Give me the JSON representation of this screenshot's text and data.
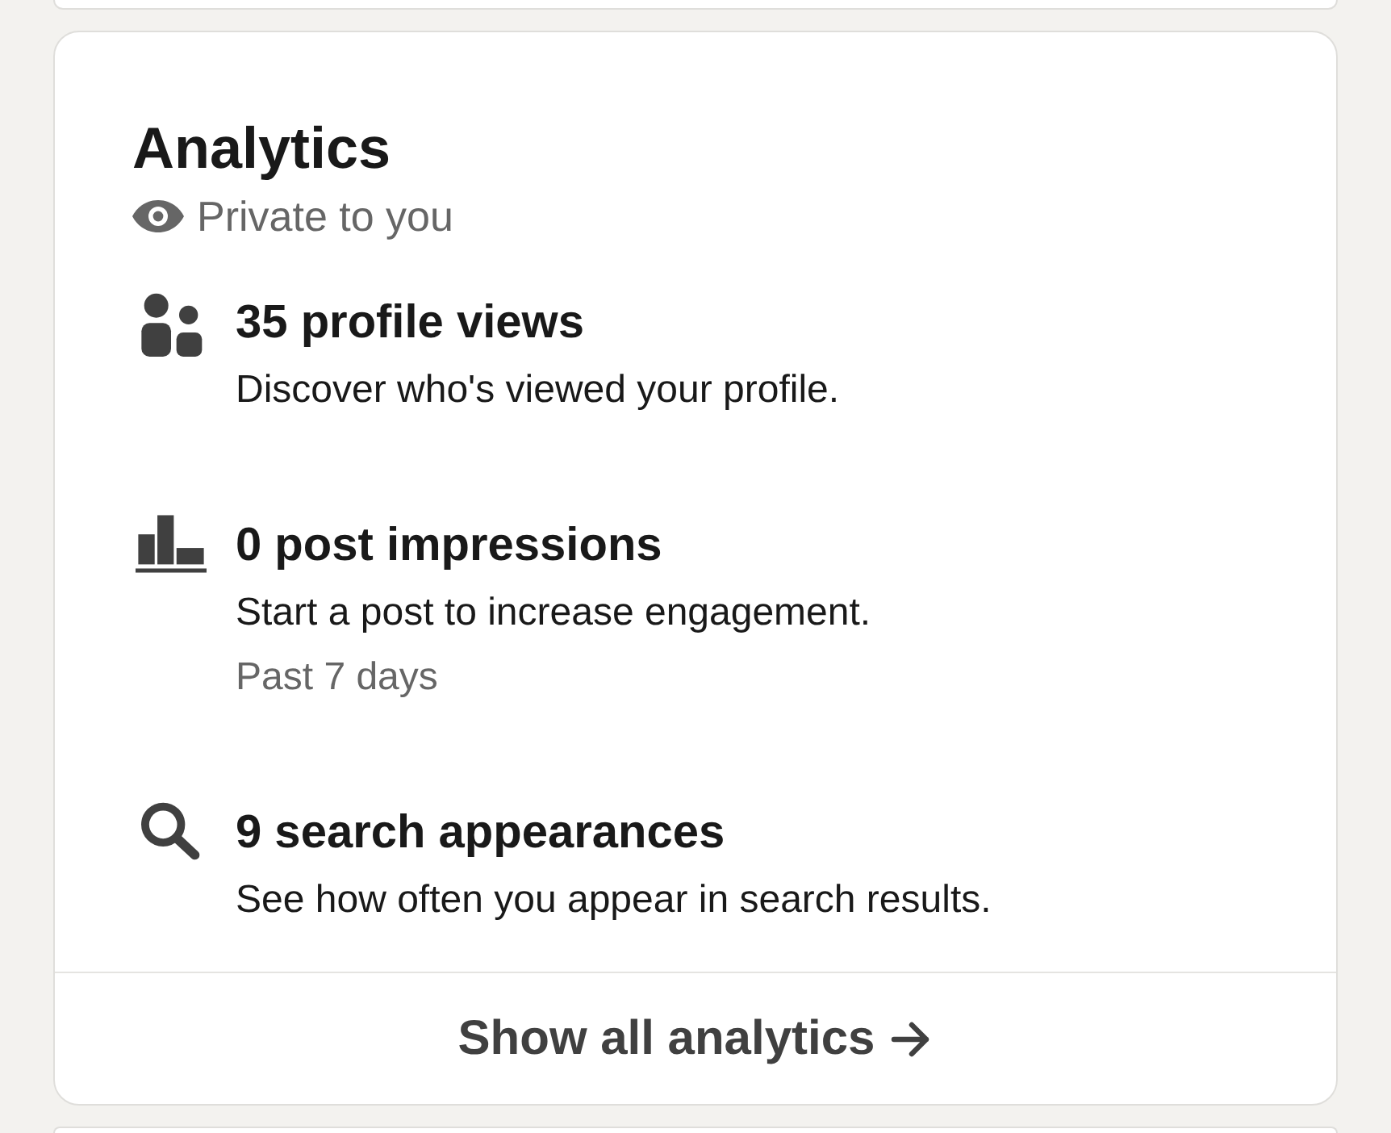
{
  "card": {
    "title": "Analytics",
    "subtitle": "Private to you"
  },
  "items": [
    {
      "kind": "views",
      "title": "35 profile views",
      "description": "Discover who's viewed your profile."
    },
    {
      "kind": "impressions",
      "title": "0 post impressions",
      "description": "Start a post to increase engagement.",
      "note": "Past 7 days"
    },
    {
      "kind": "search",
      "title": "9 search appearances",
      "description": "See how often you appear in search results."
    }
  ],
  "footer_link": {
    "label": "Show all analytics"
  }
}
